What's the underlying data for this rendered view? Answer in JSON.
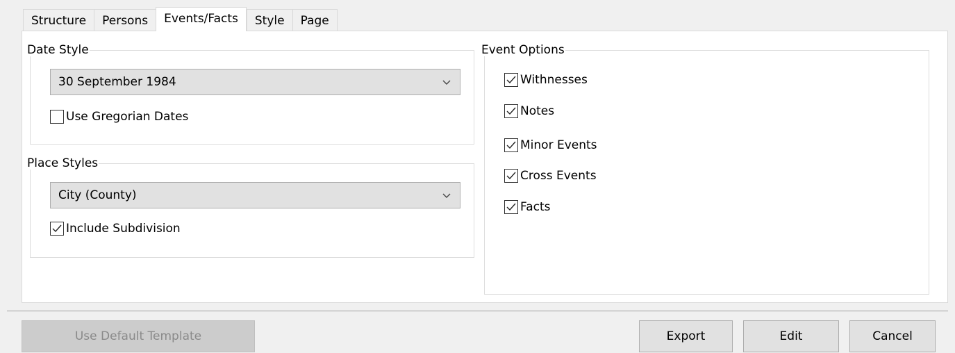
{
  "tabs": [
    {
      "label": "Structure",
      "active": false
    },
    {
      "label": "Persons",
      "active": false
    },
    {
      "label": "Events/Facts",
      "active": true
    },
    {
      "label": "Style",
      "active": false
    },
    {
      "label": "Page",
      "active": false
    }
  ],
  "date_style": {
    "legend": "Date Style",
    "selected": "30 September 1984",
    "gregorian": {
      "label": "Use Gregorian Dates",
      "checked": false
    }
  },
  "place_styles": {
    "legend": "Place Styles",
    "selected": "City (County)",
    "subdivision": {
      "label": "Include Subdivision",
      "checked": true
    }
  },
  "event_options": {
    "legend": "Event Options",
    "items": [
      {
        "label": "Withnesses",
        "checked": true
      },
      {
        "label": "Notes",
        "checked": true
      },
      {
        "label": "Minor Events",
        "checked": true
      },
      {
        "label": "Cross Events",
        "checked": true
      },
      {
        "label": "Facts",
        "checked": true
      }
    ]
  },
  "buttons": {
    "default_template": "Use Default Template",
    "export": "Export",
    "edit": "Edit",
    "cancel": "Cancel"
  }
}
